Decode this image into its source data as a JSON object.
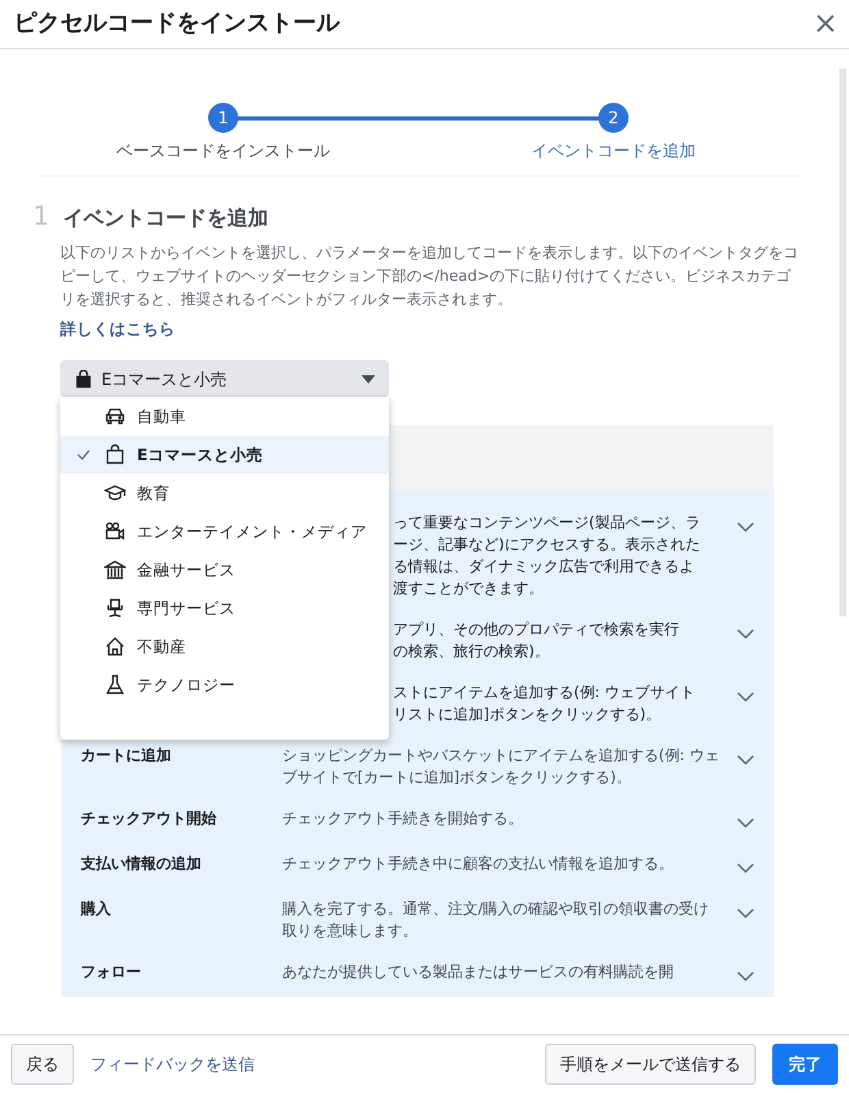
{
  "dialog": {
    "title": "ピクセルコードをインストール",
    "close": "×"
  },
  "steps": [
    {
      "number": "1",
      "label": "ベースコードをインストール",
      "current": false
    },
    {
      "number": "2",
      "label": "イベントコードを追加",
      "current": true
    }
  ],
  "section": {
    "number": "1",
    "heading": "イベントコードを追加",
    "description": "以下のリストからイベントを選択し、パラメーターを追加してコードを表示します。以下のイベントタグをコピーして、ウェブサイトのヘッダーセクション下部の</head>の下に貼り付けてください。ビジネスカテゴリを選択すると、推奨されるイベントがフィルター表示されます。",
    "link": "詳しくはこちら"
  },
  "category_select": {
    "value": "Eコマースと小売",
    "expanded": true,
    "options": [
      {
        "label": "自動車",
        "selected": false
      },
      {
        "label": "Eコマースと小売",
        "selected": true
      },
      {
        "label": "教育",
        "selected": false
      },
      {
        "label": "エンターテイメント・メディア",
        "selected": false
      },
      {
        "label": "金融サービス",
        "selected": false
      },
      {
        "label": "専門サービス",
        "selected": false
      },
      {
        "label": "不動産",
        "selected": false
      },
      {
        "label": "テクノロジー",
        "selected": false
      }
    ]
  },
  "events": [
    {
      "kind": "partial",
      "lines": [
        "って重要なコンテンツページ(製品ページ、ラ",
        "ージ、記事など)にアクセスする。表示された",
        "る情報は、ダイナミック広告で利用できるよ",
        "渡すことができます。"
      ]
    },
    {
      "kind": "partial",
      "lines": [
        "アプリ、その他のプロパティで検索を実行",
        "の検索、旅行の検索)。"
      ]
    },
    {
      "kind": "partial",
      "lines": [
        "ストにアイテムを追加する(例: ウェブサイト",
        "リストに追加]ボタンをクリックする)。"
      ]
    },
    {
      "kind": "full",
      "name": "カートに追加",
      "description": "ショッピングカートやバスケットにアイテムを追加する(例: ウェブサイトで[カートに追加]ボタンをクリックする)。"
    },
    {
      "kind": "full",
      "name": "チェックアウト開始",
      "description": "チェックアウト手続きを開始する。"
    },
    {
      "kind": "full",
      "name": "支払い情報の追加",
      "description": "チェックアウト手続き中に顧客の支払い情報を追加する。"
    },
    {
      "kind": "full",
      "name": "購入",
      "description": "購入を完了する。通常、注文/購入の確認や取引の領収書の受け取りを意味します。"
    },
    {
      "kind": "full",
      "name": "フォロー",
      "description": "あなたが提供している製品またはサービスの有料購読を開"
    }
  ],
  "footer": {
    "back": "戻る",
    "feedback": "フィードバックを送信",
    "email": "手順をメールで送信する",
    "done": "完了"
  }
}
